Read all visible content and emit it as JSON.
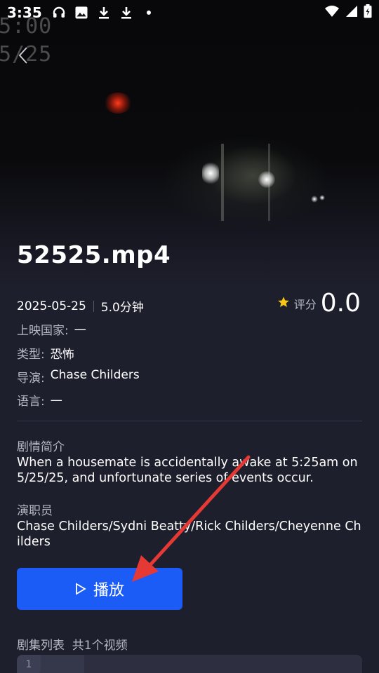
{
  "status_bar": {
    "time": "3:35",
    "icons_left": [
      "headphones-icon",
      "image-icon",
      "download-icon",
      "download-icon",
      "dot-icon"
    ],
    "icons_right": [
      "wifi-icon",
      "signal-icon",
      "battery-icon"
    ]
  },
  "video": {
    "overlay_text_line1": "5:00",
    "overlay_text_line2": "5/25"
  },
  "title": "52525.mp4",
  "meta": {
    "date": "2025-05-25",
    "duration": "5.0分钟"
  },
  "rating": {
    "label": "评分",
    "value": "0.0",
    "star_color": "#f5c518"
  },
  "info": {
    "country_label": "上映国家:",
    "country_value": "一",
    "genre_label": "类型:",
    "genre_value": "恐怖",
    "director_label": "导演:",
    "director_value": "Chase Childers",
    "language_label": "语言:",
    "language_value": "一"
  },
  "synopsis": {
    "label": "剧情简介",
    "text": "When a housemate is accidentally awake at 5:25am on 5/25/25, and unfortunate series of events occur."
  },
  "cast": {
    "label": "演职员",
    "text": "Chase Childers/Sydni Beatty/Rick Childers/Cheyenne Childers"
  },
  "play_button": {
    "label": "播放",
    "color": "#1c5cf6"
  },
  "episodes": {
    "header": "剧集列表  共1个视频",
    "items": [
      {
        "number": "1"
      }
    ]
  },
  "annotation": {
    "arrow_color": "#e53935"
  }
}
